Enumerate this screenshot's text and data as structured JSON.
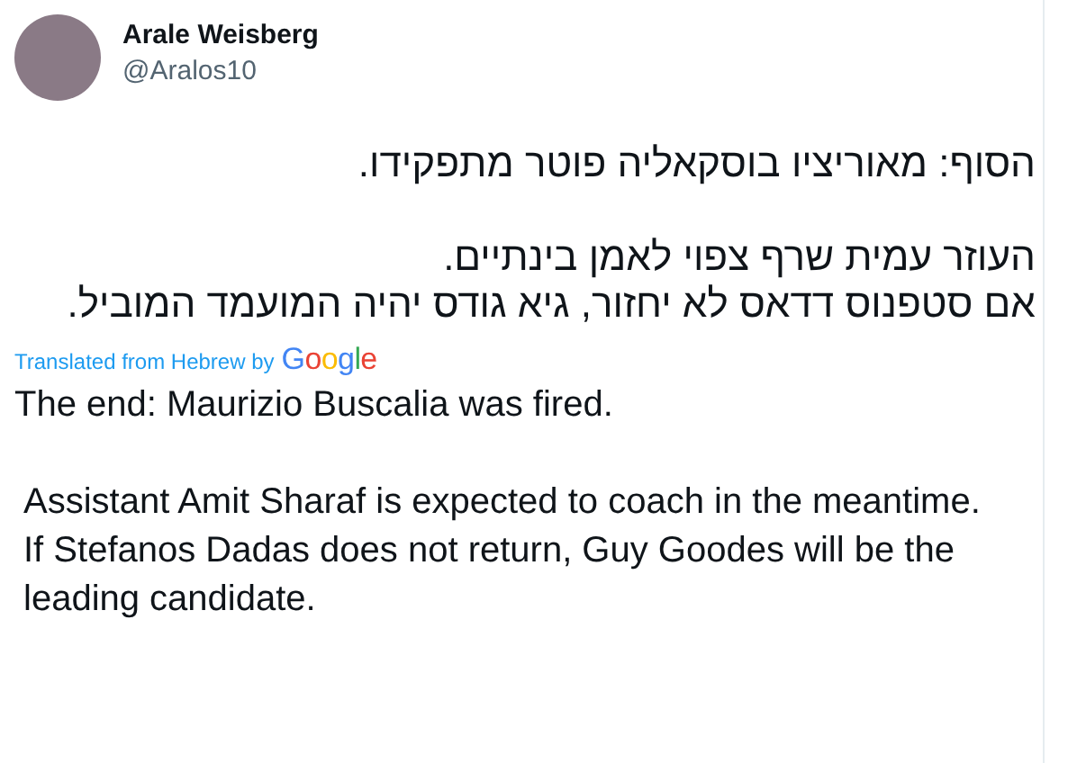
{
  "author": {
    "name": "Arale Weisberg",
    "handle": "@Aralos10"
  },
  "original_text": {
    "paragraphs": [
      [
        "הסוף: מאוריציו בוסקאליה פוטר מתפקידו."
      ],
      [
        "העוזר עמית שרף צפוי לאמן בינתיים.",
        "אם סטפנוס דדאס לא יחזור, גיא גודס יהיה המועמד המוביל."
      ]
    ]
  },
  "translation": {
    "label": "Translated from Hebrew by",
    "provider": "Google",
    "paragraphs": [
      [
        "The end: Maurizio Buscalia was fired."
      ],
      [
        "Assistant Amit Sharaf is expected to coach in the meantime.",
        "If Stefanos Dadas does not return, Guy Goodes will be the leading candidate."
      ]
    ]
  }
}
